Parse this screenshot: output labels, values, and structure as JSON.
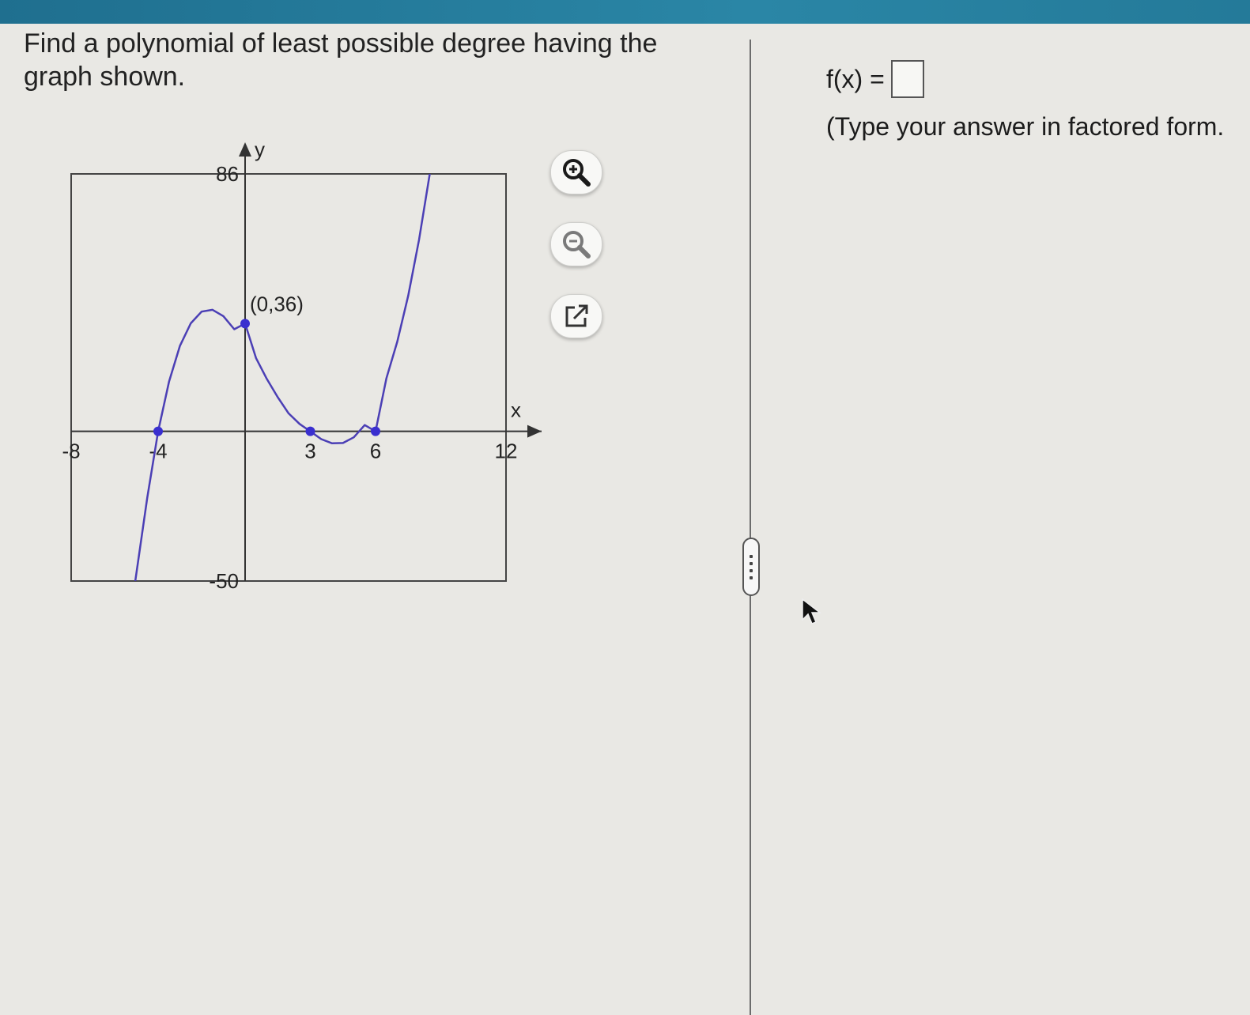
{
  "question": {
    "text": "Find a polynomial of least possible degree having the graph shown."
  },
  "answer": {
    "label": "f(x) =",
    "value": "",
    "hint": "(Type your answer in factored form."
  },
  "tools": {
    "zoom_in_icon": "zoom-in-icon",
    "zoom_out_icon": "zoom-out-icon",
    "popout_icon": "popout-icon"
  },
  "chart_data": {
    "type": "line",
    "xlabel": "x",
    "ylabel": "y",
    "xlim": [
      -8,
      12
    ],
    "ylim": [
      -50,
      86
    ],
    "x_tick_labels": [
      "-8",
      "-4",
      "3",
      "6",
      "12"
    ],
    "y_tick_labels": [
      "86",
      "-50"
    ],
    "series": [
      {
        "color": "#4b3fb5",
        "x": [
          -5.05,
          -4.5,
          -4,
          -3.5,
          -3,
          -2.5,
          -2,
          -1.5,
          -1,
          -0.5,
          0,
          0.5,
          1,
          1.5,
          2,
          2.5,
          3,
          3.5,
          4,
          4.5,
          5,
          5.5,
          6,
          6.5,
          7,
          7.5,
          8,
          8.5,
          8.9
        ],
        "y": [
          -50,
          -22.1,
          0,
          16.6,
          28.5,
          36.1,
          40,
          40.6,
          38.5,
          34.1,
          36,
          24.5,
          17.5,
          11.4,
          6,
          2.5,
          0,
          -2.6,
          -4,
          -3.9,
          -2,
          2.1,
          0,
          17.8,
          30,
          45.3,
          64,
          86.4,
          110
        ]
      }
    ],
    "points": [
      {
        "x": -4,
        "y": 0
      },
      {
        "x": 0,
        "y": 36,
        "label": "(0,36)"
      },
      {
        "x": 3,
        "y": 0
      },
      {
        "x": 6,
        "y": 0
      }
    ]
  }
}
